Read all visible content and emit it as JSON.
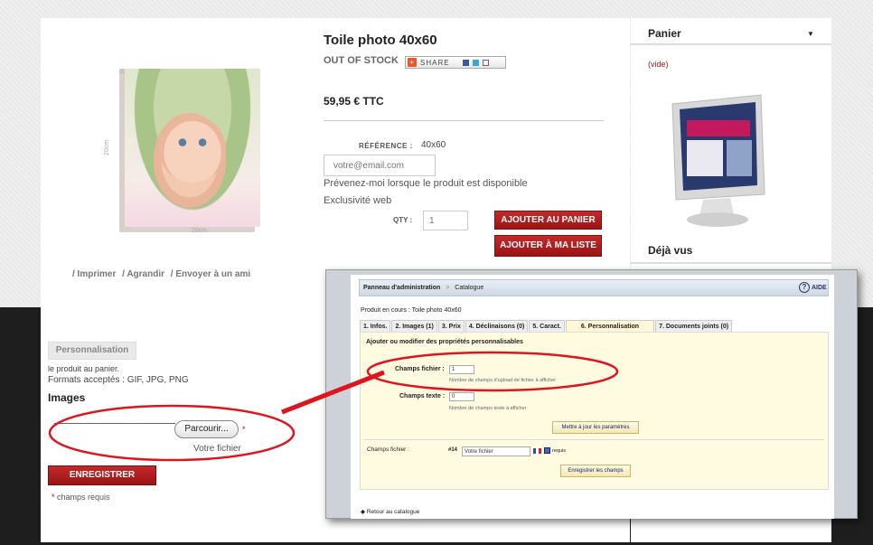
{
  "product": {
    "title": "Toile photo 40x60",
    "stock_status": "OUT OF STOCK",
    "share_label": "SHARE",
    "price": "59,95 € TTC",
    "reference_label": "RÉFÉRENCE :",
    "reference_value": "40x60",
    "email_placeholder": "votre@email.com",
    "notify_text": "Prévenez-moi lorsque le produit est disponible",
    "exclusive_text": "Exclusivité web",
    "qty_label": "QTY :",
    "qty_value": "1",
    "add_cart_label": "AJOUTER AU PANIER",
    "add_list_label": "AJOUTER À MA LISTE",
    "image_dim_width": "20cm",
    "image_dim_height": "20cm"
  },
  "image_links": [
    "/ Imprimer",
    "/ Agrandir",
    "/ Envoyer à un ami"
  ],
  "cart": {
    "title": "Panier",
    "empty_text": "(vide)",
    "seen_title": "Déjà vus"
  },
  "customization": {
    "tab_label": "Personnalisation",
    "desc_line1": "le produit au panier.",
    "desc_line2": "Formats acceptés : GIF, JPG, PNG",
    "images_heading": "Images",
    "browse_label": "Parcourir...",
    "required_star": "*",
    "file_label": "Votre fichier",
    "save_label": "ENREGISTRER",
    "required_note": "champs requis"
  },
  "admin": {
    "breadcrumb_root": "Panneau d'administration",
    "breadcrumb_sep": ">",
    "breadcrumb_current": "Catalogue",
    "help_label": "AIDE",
    "current_product": "Produit en cours : Toile photo 40x60",
    "tabs": [
      {
        "label": "1. Infos."
      },
      {
        "label": "2. Images (1)"
      },
      {
        "label": "3. Prix"
      },
      {
        "label": "4. Déclinaisons (0)"
      },
      {
        "label": "5. Caract."
      },
      {
        "label": "6. Personnalisation",
        "active": true
      },
      {
        "label": "7. Documents joints (0)"
      }
    ],
    "panel_title": "Ajouter ou modifier des propriétés personnalisables",
    "file_fields_label": "Champs fichier :",
    "file_fields_value": "1",
    "file_fields_hint": "Nombre de champs d'upload de fichier à afficher",
    "text_fields_label": "Champs texte :",
    "text_fields_value": "0",
    "text_fields_hint": "Nombre de champs texte à afficher",
    "update_button": "Mettre à jour les paramètres",
    "cf_label": "Champs fichier :",
    "cf_number": "#14",
    "cf_value": "Votre fichier",
    "cf_required": "requis",
    "save_fields_button": "Enregistrer les champs",
    "back_link": "Retour au catalogue"
  },
  "colors": {
    "accent_red": "#a41c1c",
    "annotation_red": "#e0141e"
  }
}
